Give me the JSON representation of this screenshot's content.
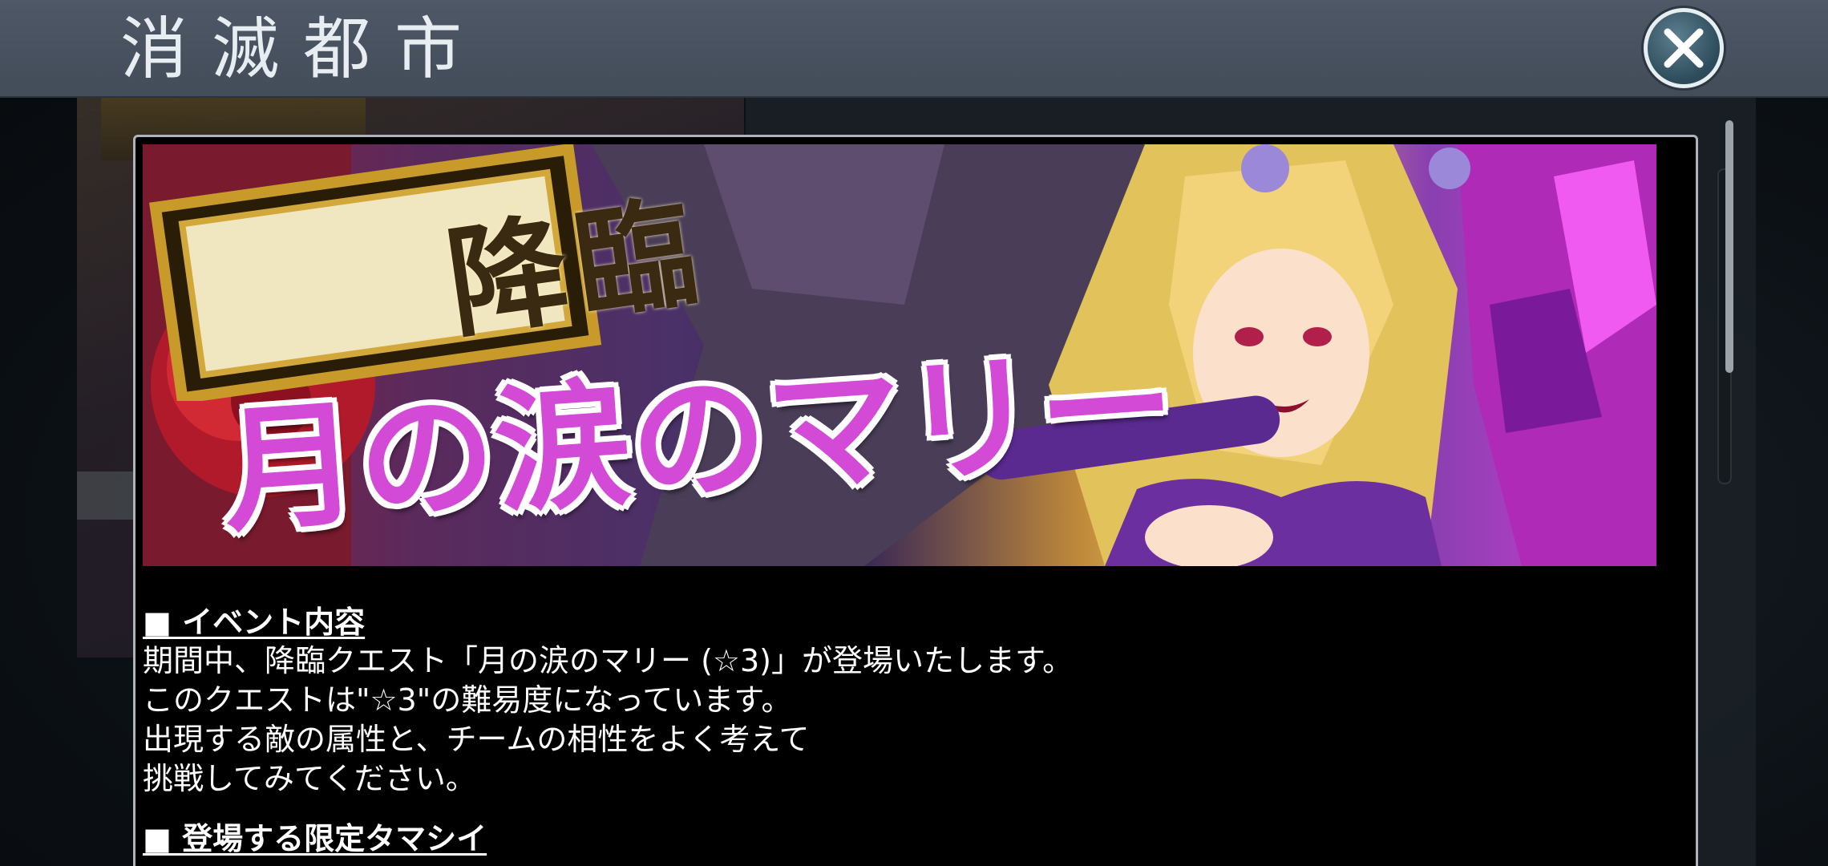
{
  "header": {
    "title": "消滅都市",
    "close_icon": "close-icon"
  },
  "banner": {
    "badge_text": "降臨",
    "main_text": "月の涙のマリー"
  },
  "content": {
    "section1_heading": "■ イベント内容",
    "section1_lines": [
      "期間中、降臨クエスト「月の涙のマリー (☆3)」が登場いたします。",
      "このクエストは\"☆3\"の難易度になっています。",
      "出現する敵の属性と、チームの相性をよく考えて",
      "挑戦してみてください。"
    ],
    "section2_heading": "■ 登場する限定タマシイ"
  },
  "colors": {
    "header_bg": "#4e5866",
    "dialog_border": "#aeb4b9",
    "banner_text_magenta": "#d34ad6"
  }
}
